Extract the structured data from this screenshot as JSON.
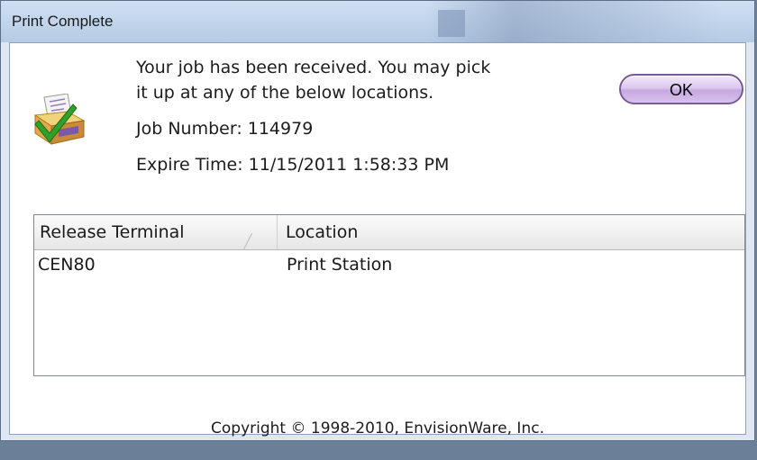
{
  "window": {
    "title": "Print Complete"
  },
  "message": {
    "line1": "Your job has been received. You may pick",
    "line2": "it up at any of the below locations.",
    "job_number": "Job Number: 114979",
    "expire_time": "Expire Time: 11/15/2011 1:58:33 PM"
  },
  "buttons": {
    "ok_label": "OK"
  },
  "icons": {
    "app_icon": "printer-checkmark-icon",
    "sort_icon": "sort-ascending-icon"
  },
  "table": {
    "columns": [
      "Release Terminal",
      "Location"
    ],
    "rows": [
      [
        "CEN80",
        "Print Station"
      ]
    ]
  },
  "footer": {
    "copyright": "Copyright © 1998-2010, EnvisionWare, Inc."
  },
  "colors": {
    "ok_button_border": "#7a5a96",
    "ok_button_fill": "#d8c2ec",
    "check_green": "#2fa12a",
    "titlebar": "#c3d6ec"
  }
}
